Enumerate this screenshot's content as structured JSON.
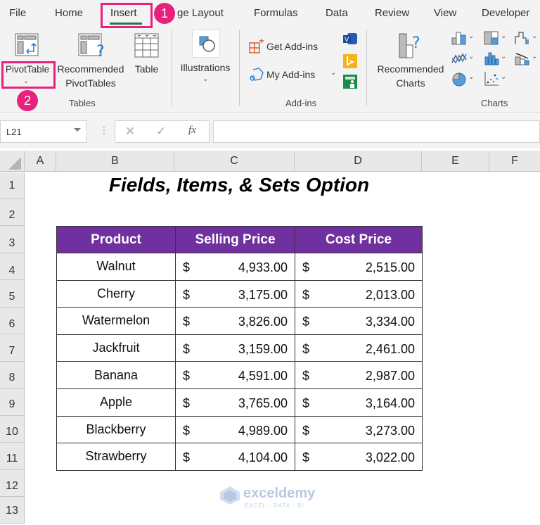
{
  "ribbon": {
    "tabs": [
      "File",
      "Home",
      "Insert",
      "ge Layout",
      "Formulas",
      "Data",
      "Review",
      "View",
      "Developer"
    ],
    "active_tab": "Insert",
    "step_badges": [
      "1",
      "2"
    ],
    "groups": {
      "tables": {
        "label": "Tables",
        "buttons": {
          "pivottable": "PivotTable",
          "recommended_pivottables_line1": "Recommended",
          "recommended_pivottables_line2": "PivotTables",
          "table": "Table"
        }
      },
      "illustrations": {
        "label": "Illustrations"
      },
      "addins": {
        "label": "Add-ins",
        "buttons": {
          "get_addins": "Get Add-ins",
          "my_addins": "My Add-ins"
        }
      },
      "charts": {
        "label": "Charts",
        "buttons": {
          "recommended_charts_line1": "Recommended",
          "recommended_charts_line2": "Charts"
        }
      }
    }
  },
  "formula_bar": {
    "name_box": "L21",
    "fx_label": "fx",
    "formula_value": ""
  },
  "sheet": {
    "columns": [
      "A",
      "B",
      "C",
      "D",
      "E",
      "F"
    ],
    "rows": [
      "1",
      "2",
      "3",
      "4",
      "5",
      "6",
      "7",
      "8",
      "9",
      "10",
      "11",
      "12",
      "13"
    ],
    "title": "Fields, Items, & Sets Option",
    "table": {
      "headers": [
        "Product",
        "Selling Price",
        "Cost Price"
      ],
      "currency_symbol": "$",
      "rows": [
        {
          "product": "Walnut",
          "selling": "4,933.00",
          "cost": "2,515.00"
        },
        {
          "product": "Cherry",
          "selling": "3,175.00",
          "cost": "2,013.00"
        },
        {
          "product": "Watermelon",
          "selling": "3,826.00",
          "cost": "3,334.00"
        },
        {
          "product": "Jackfruit",
          "selling": "3,159.00",
          "cost": "2,461.00"
        },
        {
          "product": "Banana",
          "selling": "4,591.00",
          "cost": "2,987.00"
        },
        {
          "product": "Apple",
          "selling": "3,765.00",
          "cost": "3,164.00"
        },
        {
          "product": "Blackberry",
          "selling": "4,989.00",
          "cost": "3,273.00"
        },
        {
          "product": "Strawberry",
          "selling": "4,104.00",
          "cost": "3,022.00"
        }
      ]
    }
  },
  "watermark": {
    "name": "exceldemy",
    "tagline": "EXCEL · DATA · BI"
  },
  "colors": {
    "header_fill": "#7030a0",
    "highlight": "#e8217e",
    "active_tab_underline": "#1e7a45"
  }
}
